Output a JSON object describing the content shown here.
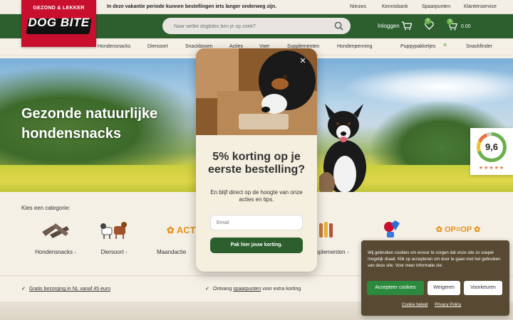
{
  "topbar": {
    "notice": "In deze vakantie periode kunnen bestellingen iets langer onderweg zijn.",
    "links": [
      "Nieuws",
      "Kennisbank",
      "Spaarpunten",
      "Klantenservice"
    ]
  },
  "logo": {
    "tagline": "GEZOND & LEKKER",
    "brand": "DOG BITE"
  },
  "search": {
    "placeholder": "Naar welke dogbites ben je op zoek?"
  },
  "header": {
    "login": "Inloggen",
    "wishlist_count": "0",
    "cart_count": "0",
    "cart_total": "0.00"
  },
  "nav": {
    "items": [
      "Hondensnacks",
      "Diersoort",
      "Snackboxen",
      "Acties",
      "Voer",
      "Supplementen",
      "Hondenpenning",
      "Puppypakketjes",
      "Snackfinder"
    ]
  },
  "hero": {
    "title": "Gezonde natuurlijke hondensnacks"
  },
  "rating": {
    "score": "9,6",
    "stars": "★★★★★"
  },
  "categories": {
    "title": "Kies een categorie:",
    "items": [
      {
        "label": "Hondensnacks",
        "icon": "snacks-image"
      },
      {
        "label": "Diersoort",
        "icon": "animals-image"
      },
      {
        "label": "Maandactie",
        "icon": "action-image",
        "badge": "ACTI"
      },
      {
        "label": "Supplementen",
        "icon": "supplements-image"
      },
      {
        "label": "",
        "icon": "balloon-image"
      },
      {
        "label": "",
        "icon": "op-op-image",
        "badge": "OP=OP"
      }
    ]
  },
  "usps": [
    {
      "text": "Gratis bezorging in NL vanaf 45 euro"
    },
    {
      "pre": "Ontvang ",
      "link": "spaarpunten",
      "post": " voor extra korting"
    }
  ],
  "modal": {
    "title": "5% korting op je eerste bestelling?",
    "subtitle": "En blijf direct op de hoogte van onze acties en tips.",
    "email_placeholder": "Email",
    "cta": "Pak hier jouw korting."
  },
  "cookie": {
    "text": "Wij gebruiken cookies om ervoor te zorgen dat onze site zo soepel mogelijk draait. Klik op accepteren om door te gaan met het gebruiken van deze site. Voor meer informatie zie:",
    "accept": "Accepteer cookies",
    "reject": "Weigeren",
    "preferences": "Voorkeuren",
    "policy_links": [
      "Cookie beleid",
      "Privacy Policy"
    ]
  },
  "colors": {
    "brand_red": "#c8102e",
    "brand_green": "#2c5e2e",
    "cream": "#f5f0e6",
    "cookie_bg": "#574932"
  }
}
